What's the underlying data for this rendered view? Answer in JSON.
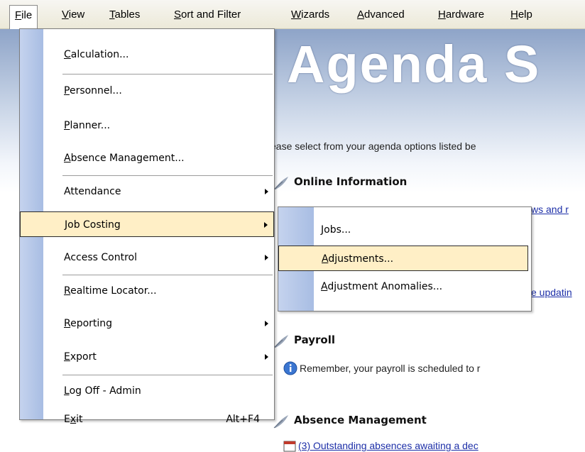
{
  "menubar": {
    "items": [
      {
        "label": "File",
        "accel": "F"
      },
      {
        "label": "View",
        "accel": "V"
      },
      {
        "label": "Tables",
        "accel": "T"
      },
      {
        "label": "Sort and Filter",
        "accel": "S"
      },
      {
        "label": "Wizards",
        "accel": "W"
      },
      {
        "label": "Advanced",
        "accel": "A"
      },
      {
        "label": "Hardware",
        "accel": "H"
      },
      {
        "label": "Help",
        "accel": "H"
      }
    ]
  },
  "file_menu": {
    "items": [
      {
        "label": "Calculation...",
        "accel": "C"
      },
      {
        "label": "Personnel...",
        "accel": "P"
      },
      {
        "label": "Planner...",
        "accel": "P"
      },
      {
        "label": "Absence Management...",
        "accel": "A"
      },
      {
        "label": "Attendance"
      },
      {
        "label": "Job Costing"
      },
      {
        "label": "Access Control"
      },
      {
        "label": "Realtime Locator...",
        "accel": "R"
      },
      {
        "label": "Reporting",
        "accel": "R"
      },
      {
        "label": "Export",
        "accel": "E"
      },
      {
        "label": "Log Off - Admin",
        "accel": "L"
      },
      {
        "label": "Exit",
        "accel": "x",
        "shortcut": "Alt+F4"
      }
    ]
  },
  "job_costing_submenu": {
    "items": [
      {
        "label": "Jobs...",
        "accel": "J"
      },
      {
        "label": "Adjustments...",
        "accel": "A"
      },
      {
        "label": "Adjustment Anomalies...",
        "accel": "A"
      }
    ]
  },
  "agenda": {
    "title": "Agenda S",
    "intro": "ease select from your agenda options listed be",
    "online_heading": "Online Information",
    "online_link": "ws and r",
    "online_link2": "e updatin",
    "payroll_heading": "Payroll",
    "payroll_text": "Remember, your payroll is scheduled to r",
    "absence_heading": "Absence Management",
    "absence_text": "(3) Outstanding absences awaiting a dec"
  },
  "colors": {
    "highlight": "#ffefc6",
    "gutter": "#b3c6e8",
    "link": "#1d2fa8"
  }
}
